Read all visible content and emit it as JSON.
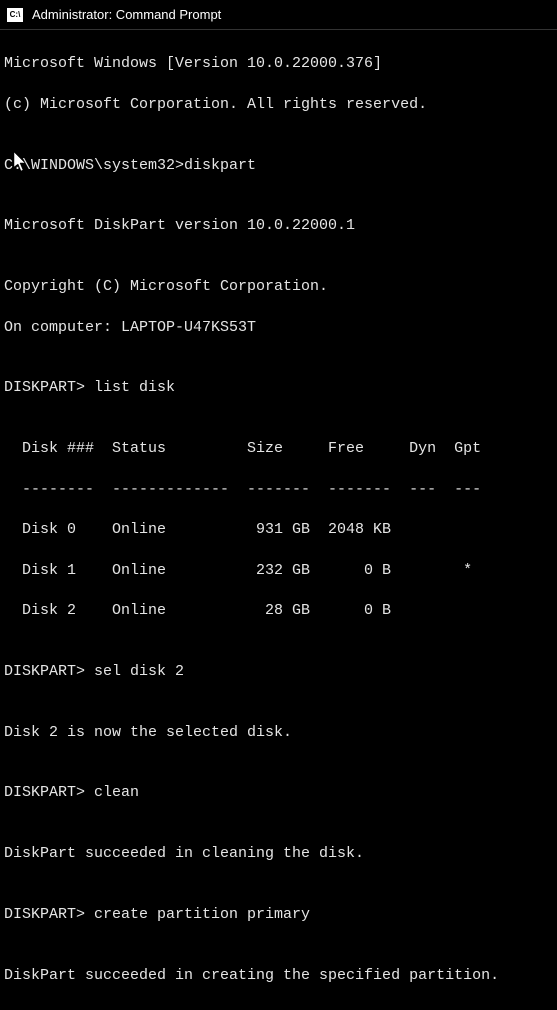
{
  "titlebar": {
    "icon_label": "C:\\",
    "title": "Administrator: Command Prompt"
  },
  "lines": {
    "l0": "Microsoft Windows [Version 10.0.22000.376]",
    "l1": "(c) Microsoft Corporation. All rights reserved.",
    "l2": "",
    "l3": "C:\\WINDOWS\\system32>diskpart",
    "l4": "",
    "l5": "Microsoft DiskPart version 10.0.22000.1",
    "l6": "",
    "l7": "Copyright (C) Microsoft Corporation.",
    "l8": "On computer: LAPTOP-U47KS53T",
    "l9": "",
    "l10": "DISKPART> list disk",
    "l11": "",
    "l12": "  Disk ###  Status         Size     Free     Dyn  Gpt",
    "l13": "  --------  -------------  -------  -------  ---  ---",
    "l14": "  Disk 0    Online          931 GB  2048 KB",
    "l15": "  Disk 1    Online          232 GB      0 B        *",
    "l16": "  Disk 2    Online           28 GB      0 B",
    "l17": "",
    "l18": "DISKPART> sel disk 2",
    "l19": "",
    "l20": "Disk 2 is now the selected disk.",
    "l21": "",
    "l22": "DISKPART> clean",
    "l23": "",
    "l24": "DiskPart succeeded in cleaning the disk.",
    "l25": "",
    "l26": "DISKPART> create partition primary",
    "l27": "",
    "l28": "DiskPart succeeded in creating the specified partition."
  },
  "disk_table": {
    "headers": [
      "Disk ###",
      "Status",
      "Size",
      "Free",
      "Dyn",
      "Gpt"
    ],
    "rows": [
      {
        "disk": "Disk 0",
        "status": "Online",
        "size": "931 GB",
        "free": "2048 KB",
        "dyn": "",
        "gpt": ""
      },
      {
        "disk": "Disk 1",
        "status": "Online",
        "size": "232 GB",
        "free": "0 B",
        "dyn": "",
        "gpt": "*"
      },
      {
        "disk": "Disk 2",
        "status": "Online",
        "size": "28 GB",
        "free": "0 B",
        "dyn": "",
        "gpt": ""
      }
    ]
  },
  "commands": {
    "initial_prompt": "C:\\WINDOWS\\system32>",
    "initial_cmd": "diskpart",
    "dp_prompt": "DISKPART>",
    "cmd1": "list disk",
    "cmd2": "sel disk 2",
    "cmd3": "clean",
    "cmd4": "create partition primary"
  },
  "version": {
    "windows": "10.0.22000.376",
    "diskpart": "10.0.22000.1"
  },
  "computer_name": "LAPTOP-U47KS53T"
}
